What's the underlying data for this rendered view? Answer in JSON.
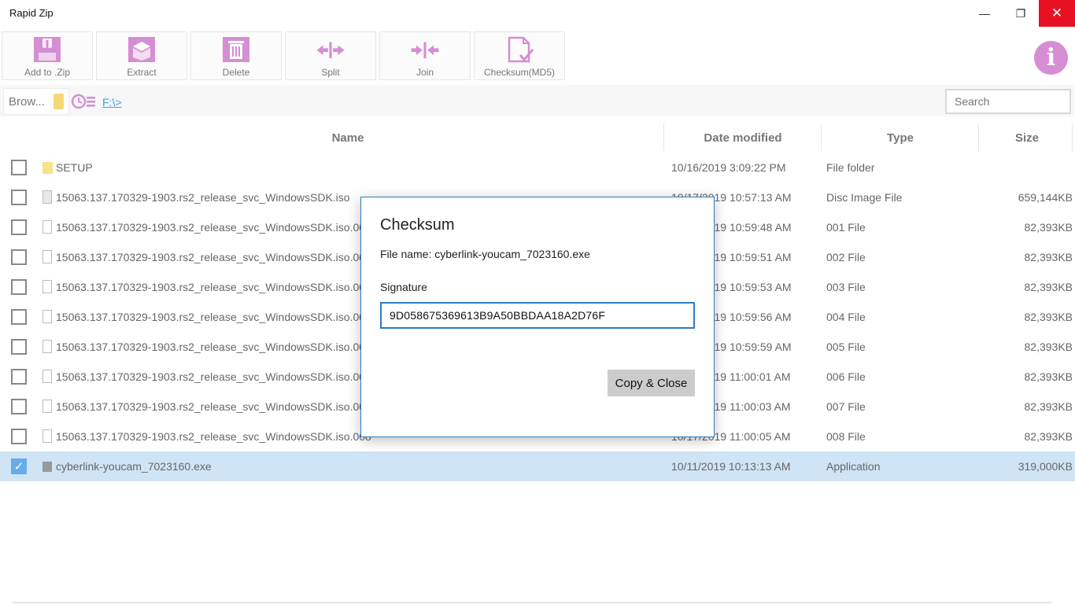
{
  "window": {
    "title": "Rapid Zip",
    "minimize_glyph": "—",
    "restore_glyph": "❐",
    "close_glyph": "✕"
  },
  "toolbar": {
    "accent_color": "#d58ed4",
    "buttons": [
      {
        "label": "Add to .Zip",
        "icon": "add-to-zip-icon"
      },
      {
        "label": "Extract",
        "icon": "extract-box-icon"
      },
      {
        "label": "Delete",
        "icon": "trash-icon"
      },
      {
        "label": "Split",
        "icon": "split-arrows-icon"
      },
      {
        "label": "Join",
        "icon": "join-arrows-icon"
      },
      {
        "label": "Checksum(MD5)",
        "icon": "checksum-document-icon"
      }
    ],
    "info_glyph": "i"
  },
  "address": {
    "browse_label": "Brow...",
    "path": "F:\\>",
    "search_placeholder": "Search"
  },
  "columns": {
    "name": "Name",
    "date": "Date modified",
    "type": "Type",
    "size": "Size"
  },
  "files": [
    {
      "name": "SETUP",
      "date": "10/16/2019 3:09:22 PM",
      "type": "File folder",
      "size": "",
      "kind": "folder",
      "checked": false
    },
    {
      "name": "15063.137.170329-1903.rs2_release_svc_WindowsSDK.iso",
      "date": "10/17/2019 10:57:13 AM",
      "type": "Disc Image File",
      "size": "659,144KB",
      "kind": "disc",
      "checked": false
    },
    {
      "name": "15063.137.170329-1903.rs2_release_svc_WindowsSDK.iso.001",
      "date": "10/17/2019 10:59:48 AM",
      "type": "001 File",
      "size": "82,393KB",
      "kind": "file",
      "checked": false
    },
    {
      "name": "15063.137.170329-1903.rs2_release_svc_WindowsSDK.iso.002",
      "date": "10/17/2019 10:59:51 AM",
      "type": "002 File",
      "size": "82,393KB",
      "kind": "file",
      "checked": false
    },
    {
      "name": "15063.137.170329-1903.rs2_release_svc_WindowsSDK.iso.003",
      "date": "10/17/2019 10:59:53 AM",
      "type": "003 File",
      "size": "82,393KB",
      "kind": "file",
      "checked": false
    },
    {
      "name": "15063.137.170329-1903.rs2_release_svc_WindowsSDK.iso.004",
      "date": "10/17/2019 10:59:56 AM",
      "type": "004 File",
      "size": "82,393KB",
      "kind": "file",
      "checked": false
    },
    {
      "name": "15063.137.170329-1903.rs2_release_svc_WindowsSDK.iso.005",
      "date": "10/17/2019 10:59:59 AM",
      "type": "005 File",
      "size": "82,393KB",
      "kind": "file",
      "checked": false
    },
    {
      "name": "15063.137.170329-1903.rs2_release_svc_WindowsSDK.iso.006",
      "date": "10/17/2019 11:00:01 AM",
      "type": "006 File",
      "size": "82,393KB",
      "kind": "file",
      "checked": false
    },
    {
      "name": "15063.137.170329-1903.rs2_release_svc_WindowsSDK.iso.007",
      "date": "10/17/2019 11:00:03 AM",
      "type": "007 File",
      "size": "82,393KB",
      "kind": "file",
      "checked": false
    },
    {
      "name": "15063.137.170329-1903.rs2_release_svc_WindowsSDK.iso.008",
      "date": "10/17/2019 11:00:05 AM",
      "type": "008 File",
      "size": "82,393KB",
      "kind": "file",
      "checked": false
    },
    {
      "name": "cyberlink-youcam_7023160.exe",
      "date": "10/11/2019 10:13:13 AM",
      "type": "Application",
      "size": "319,000KB",
      "kind": "app",
      "checked": true
    }
  ],
  "dialog": {
    "title": "Checksum",
    "file_name": "File name: cyberlink-youcam_7023160.exe",
    "signature_label": "Signature",
    "signature_value": "9D058675369613B9A50BBDAA18A2D76F",
    "copy_button": "Copy & Close"
  }
}
